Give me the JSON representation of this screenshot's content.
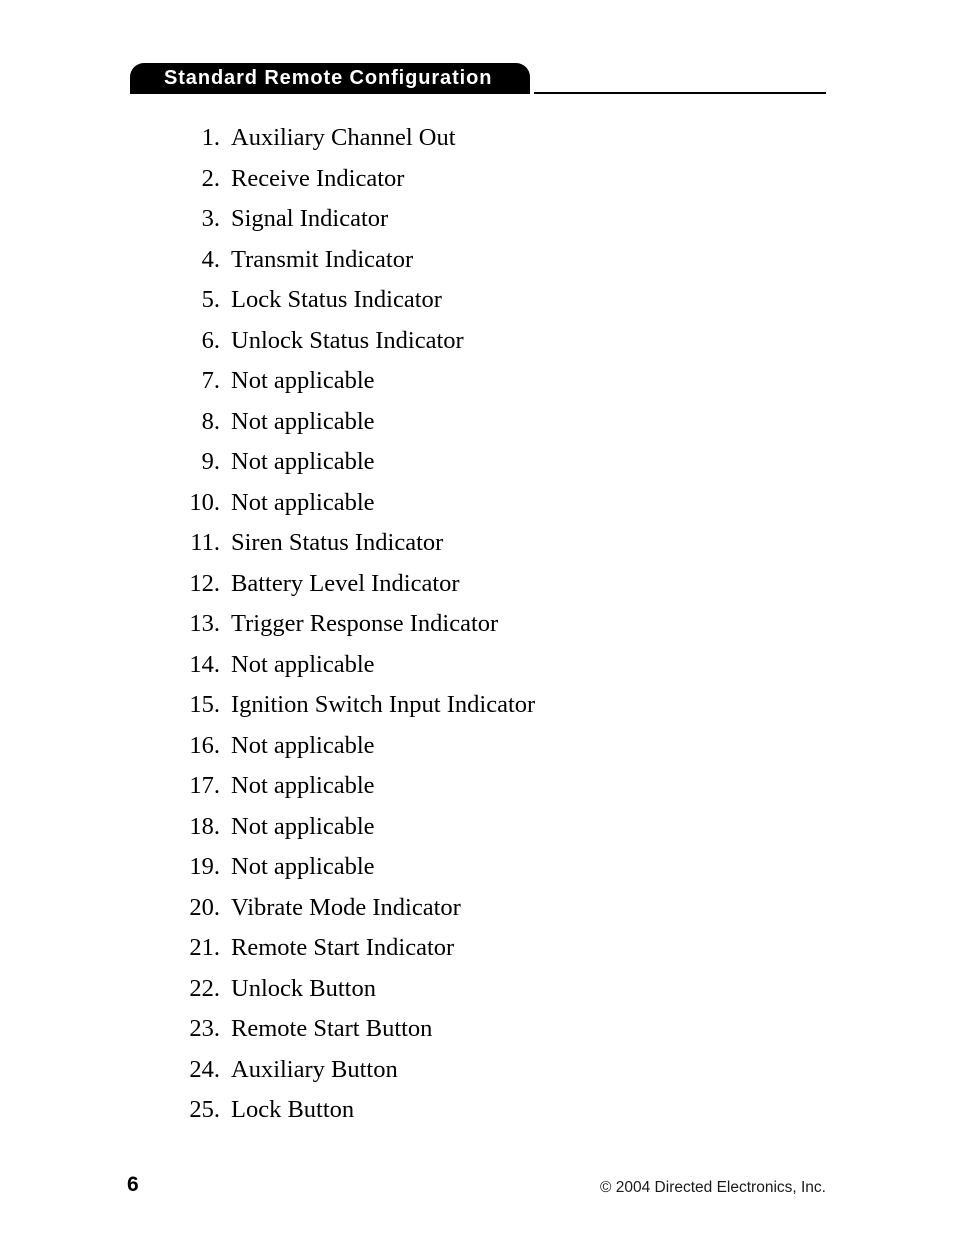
{
  "page": {
    "background_color": "#ffffff",
    "text_color": "#000000"
  },
  "header": {
    "banner_title": "Standard Remote Configuration",
    "banner_color": "#000000",
    "banner_text_color": "#ffffff",
    "rule_color": "#000000"
  },
  "main": {
    "items": [
      {
        "number": "1.",
        "label": "Auxiliary Channel Out"
      },
      {
        "number": "2.",
        "label": "Receive Indicator"
      },
      {
        "number": "3.",
        "label": "Signal Indicator"
      },
      {
        "number": "4.",
        "label": "Transmit Indicator"
      },
      {
        "number": "5.",
        "label": "Lock Status Indicator"
      },
      {
        "number": "6.",
        "label": "Unlock Status Indicator"
      },
      {
        "number": "7.",
        "label": "Not applicable"
      },
      {
        "number": "8.",
        "label": "Not applicable"
      },
      {
        "number": "9.",
        "label": "Not applicable"
      },
      {
        "number": "10.",
        "label": "Not applicable"
      },
      {
        "number": "11.",
        "label": "Siren Status Indicator"
      },
      {
        "number": "12.",
        "label": "Battery Level Indicator"
      },
      {
        "number": "13.",
        "label": "Trigger Response Indicator"
      },
      {
        "number": "14.",
        "label": "Not applicable"
      },
      {
        "number": "15.",
        "label": "Ignition Switch Input Indicator"
      },
      {
        "number": "16.",
        "label": "Not applicable"
      },
      {
        "number": "17.",
        "label": "Not applicable"
      },
      {
        "number": "18.",
        "label": "Not applicable"
      },
      {
        "number": "19.",
        "label": "Not applicable"
      },
      {
        "number": "20.",
        "label": "Vibrate Mode Indicator"
      },
      {
        "number": "21.",
        "label": "Remote Start Indicator"
      },
      {
        "number": "22.",
        "label": "Unlock Button"
      },
      {
        "number": "23.",
        "label": "Remote Start Button"
      },
      {
        "number": "24.",
        "label": "Auxiliary Button"
      },
      {
        "number": "25.",
        "label": "Lock Button"
      }
    ]
  },
  "footer": {
    "page_number": "6",
    "copyright": "© 2004 Directed Electronics, Inc."
  }
}
